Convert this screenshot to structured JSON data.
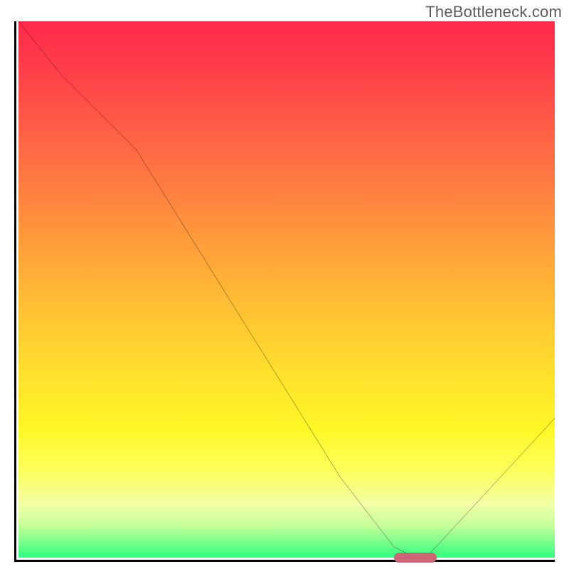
{
  "watermark": "TheBottleneck.com",
  "chart_data": {
    "type": "line",
    "title": "",
    "xlabel": "",
    "ylabel": "",
    "xlim": [
      0,
      100
    ],
    "ylim": [
      0,
      100
    ],
    "grid": false,
    "legend": false,
    "series": [
      {
        "name": "bottleneck-curve",
        "x": [
          0,
          8,
          22,
          60,
          70,
          74,
          76,
          100
        ],
        "values": [
          100,
          90,
          76,
          15,
          2,
          0,
          0,
          26
        ]
      }
    ],
    "marker": {
      "name": "optimal-range",
      "x_start": 70,
      "x_end": 78,
      "y": 0
    },
    "background_gradient": {
      "stops": [
        {
          "pos": 0.0,
          "color": "#ff2a49"
        },
        {
          "pos": 0.5,
          "color": "#ffb836"
        },
        {
          "pos": 0.85,
          "color": "#f8ff60"
        },
        {
          "pos": 1.0,
          "color": "#2dff7f"
        }
      ],
      "direction": "top-to-bottom"
    }
  },
  "colors": {
    "curve": "#000000",
    "marker": "#cc6677",
    "axis": "#000000"
  }
}
